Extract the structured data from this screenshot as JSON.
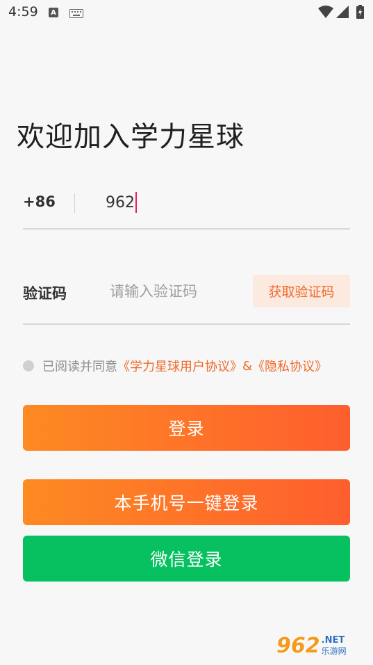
{
  "status_bar": {
    "time": "4:59",
    "a_badge": "A",
    "icons": [
      "keyboard-icon",
      "wifi-icon",
      "signal-icon",
      "battery-icon"
    ]
  },
  "title": "欢迎加入学力星球",
  "phone": {
    "country_code": "+86",
    "value": "962"
  },
  "code": {
    "label": "验证码",
    "placeholder": "请输入验证码",
    "get_code_button": "获取验证码"
  },
  "agreement": {
    "checked": false,
    "prefix": "已阅读并同意",
    "user_agreement": "《学力星球用户协议》",
    "separator": "&",
    "privacy": "《隐私协议》"
  },
  "buttons": {
    "login": "登录",
    "one_key_login": "本手机号一键登录",
    "wechat_login": "微信登录"
  },
  "watermark": {
    "number": "962",
    "net": ".NET",
    "cn": "乐游网"
  },
  "colors": {
    "accent": "#ef6a2a",
    "orange_start": "#fd8a22",
    "orange_end": "#fe5e2e",
    "wechat_green": "#07c160",
    "caret": "#e91e63"
  }
}
